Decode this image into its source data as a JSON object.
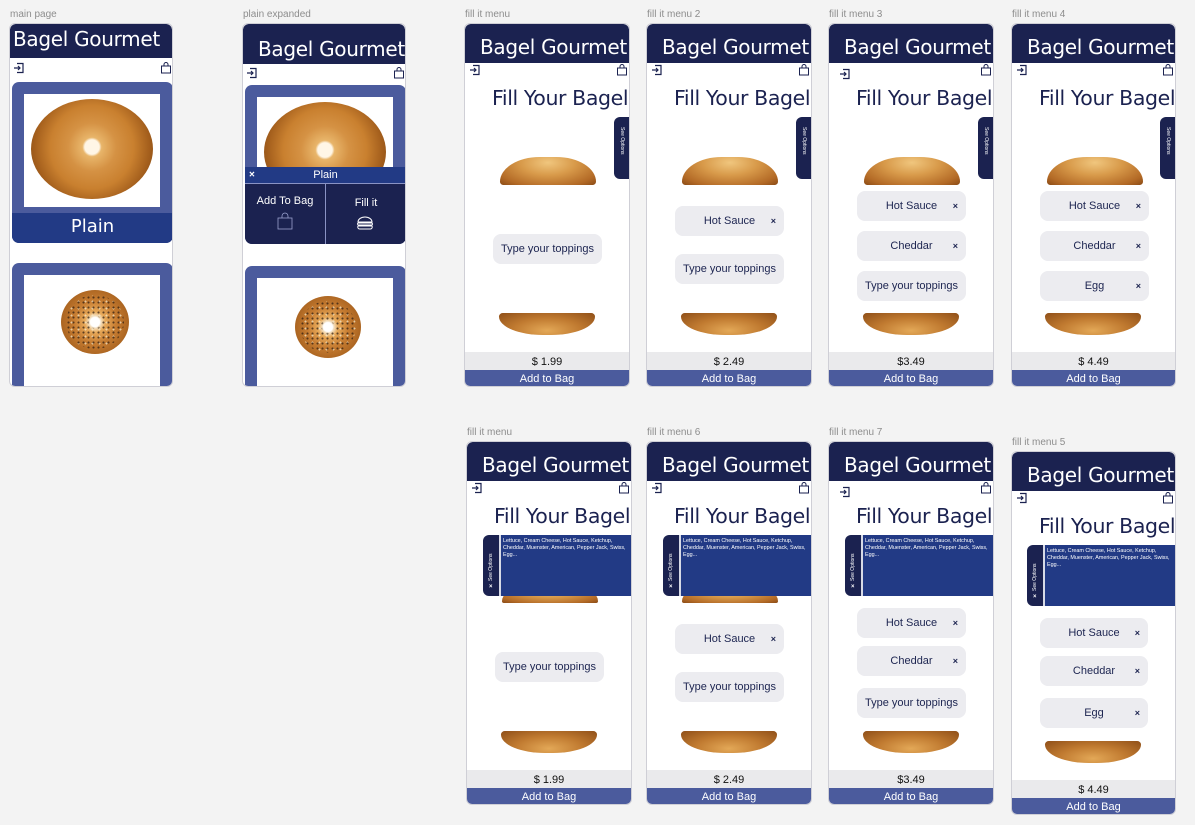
{
  "artboards": {
    "main": "main page",
    "plain_expanded": "plain expanded",
    "fill_1": "fill it menu",
    "fill_2": "fill it menu 2",
    "fill_3": "fill it menu 3",
    "fill_4": "fill it menu 4",
    "fill_b1": "fill it menu",
    "fill_6": "fill it menu 6",
    "fill_7": "fill it menu 7",
    "fill_5": "fill it menu 5"
  },
  "app": {
    "title": "Bagel Gourmet",
    "fill_title": "Fill Your Bagel",
    "add_to_bag": "Add to Bag",
    "see_options": "See Options",
    "options_text": "Lettuce, Cream Cheese, Hot Sauce, Ketchup, Cheddar, Muenster, American, Pepper Jack, Swiss, Egg...",
    "placeholder": "Type your toppings",
    "remove": "×"
  },
  "main_page": {
    "card_label": "Plain"
  },
  "plain_expanded": {
    "popup_label": "Plain",
    "add_to_bag": "Add To Bag",
    "fill_it": "Fill it",
    "close": "×"
  },
  "toppings": {
    "hot_sauce": "Hot Sauce",
    "cheddar": "Cheddar",
    "egg": "Egg"
  },
  "prices": {
    "p1": "$ 1.99",
    "p2": "$ 2.49",
    "p3": "$3.49",
    "p4": "$ 4.49"
  },
  "colors": {
    "header": "#1b2250",
    "accent": "#4b5b9d",
    "options_panel": "#223a85",
    "background": "#f3f3f3"
  },
  "icons": {
    "nav_left": "exit-icon",
    "nav_right": "bag-icon"
  }
}
